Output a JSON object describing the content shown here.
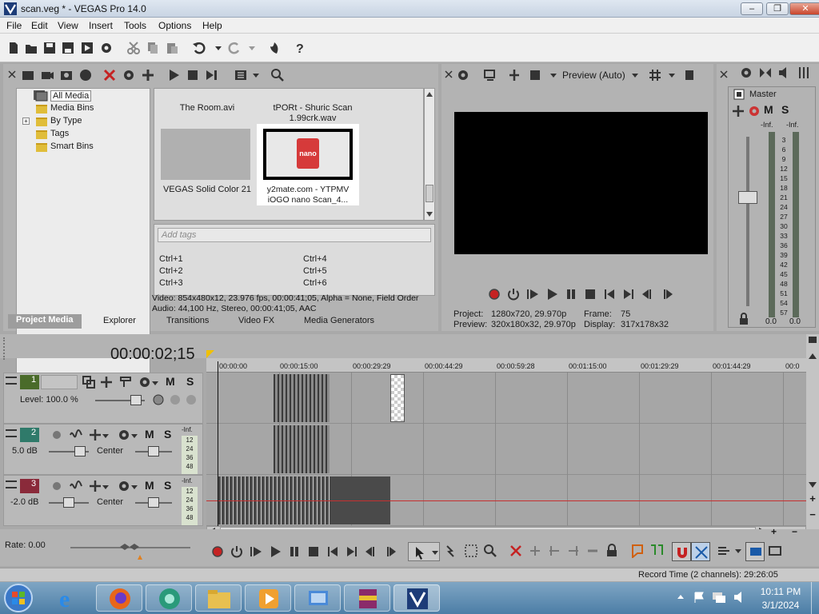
{
  "window": {
    "title": "scan.veg * - VEGAS Pro 14.0",
    "min": "–",
    "max": "❐",
    "close": "✕"
  },
  "menu": [
    "File",
    "Edit",
    "View",
    "Insert",
    "Tools",
    "Options",
    "Help"
  ],
  "tree": {
    "items": [
      "All Media",
      "Media Bins",
      "By Type",
      "Tags",
      "Smart Bins"
    ],
    "expander": "+"
  },
  "media": {
    "items": [
      {
        "name": "The Room.avi"
      },
      {
        "name": "tPORt - Shuric Scan 1.99crk.wav"
      },
      {
        "name": "VEGAS Solid Color 21"
      },
      {
        "name": "y2mate.com - YTPMV iOGO nano Scan_4..."
      }
    ],
    "thumb_text": "nano",
    "tags_placeholder": "Add tags",
    "shortcuts": [
      "Ctrl+1",
      "Ctrl+2",
      "Ctrl+3",
      "Ctrl+4",
      "Ctrl+5",
      "Ctrl+6"
    ],
    "info_video": "Video: 854x480x12, 23.976 fps, 00:00:41;05, Alpha = None, Field Order",
    "info_audio": "Audio: 44,100 Hz, Stereo, 00:00:41;05, AAC"
  },
  "tabs": [
    "Project Media",
    "Explorer",
    "Transitions",
    "Video FX",
    "Media Generators"
  ],
  "preview": {
    "mode": "Preview (Auto)",
    "project_label": "Project:",
    "project_value": "1280x720, 29.970p",
    "frame_label": "Frame:",
    "frame_value": "75",
    "preview_label": "Preview:",
    "preview_value": "320x180x32, 29.970p",
    "display_label": "Display:",
    "display_value": "317x178x32"
  },
  "master": {
    "label": "Master",
    "m": "M",
    "s": "S",
    "inf_left": "-Inf.",
    "inf_right": "-Inf.",
    "scale": [
      "3",
      "6",
      "9",
      "12",
      "15",
      "18",
      "21",
      "24",
      "27",
      "30",
      "33",
      "36",
      "39",
      "42",
      "45",
      "48",
      "51",
      "54",
      "57"
    ],
    "bottom_left": "0.0",
    "bottom_right": "0.0"
  },
  "timeline": {
    "timecode": "00:00:02;15",
    "ruler": [
      "00:00:00",
      "00:00:15:00",
      "00:00:29:29",
      "00:00:44:29",
      "00:00:59:28",
      "00:01:15:00",
      "00:01:29:29",
      "00:01:44:29",
      "00:0"
    ],
    "tracks": [
      {
        "num": "1",
        "label": "Level: 100.0 %",
        "m": "M",
        "s": "S"
      },
      {
        "num": "2",
        "label": "5.0 dB",
        "pan": "Center",
        "m": "M",
        "s": "S",
        "inf": "-Inf.",
        "meter": [
          "12",
          "24",
          "36",
          "48"
        ]
      },
      {
        "num": "3",
        "label": "-2.0 dB",
        "pan": "Center",
        "m": "M",
        "s": "S",
        "inf": "-Inf.",
        "meter": [
          "12",
          "24",
          "36",
          "48"
        ]
      }
    ],
    "rate": "Rate: 0.00"
  },
  "status": {
    "record_time": "Record Time (2 channels): 29:26:05"
  },
  "taskbar": {
    "time": "10:11 PM",
    "date": "3/1/2024"
  },
  "colors": {
    "track1": "#4a6b2a",
    "track2": "#2f7a6a",
    "track3": "#8a2a3a",
    "accent": "#f0c000"
  }
}
